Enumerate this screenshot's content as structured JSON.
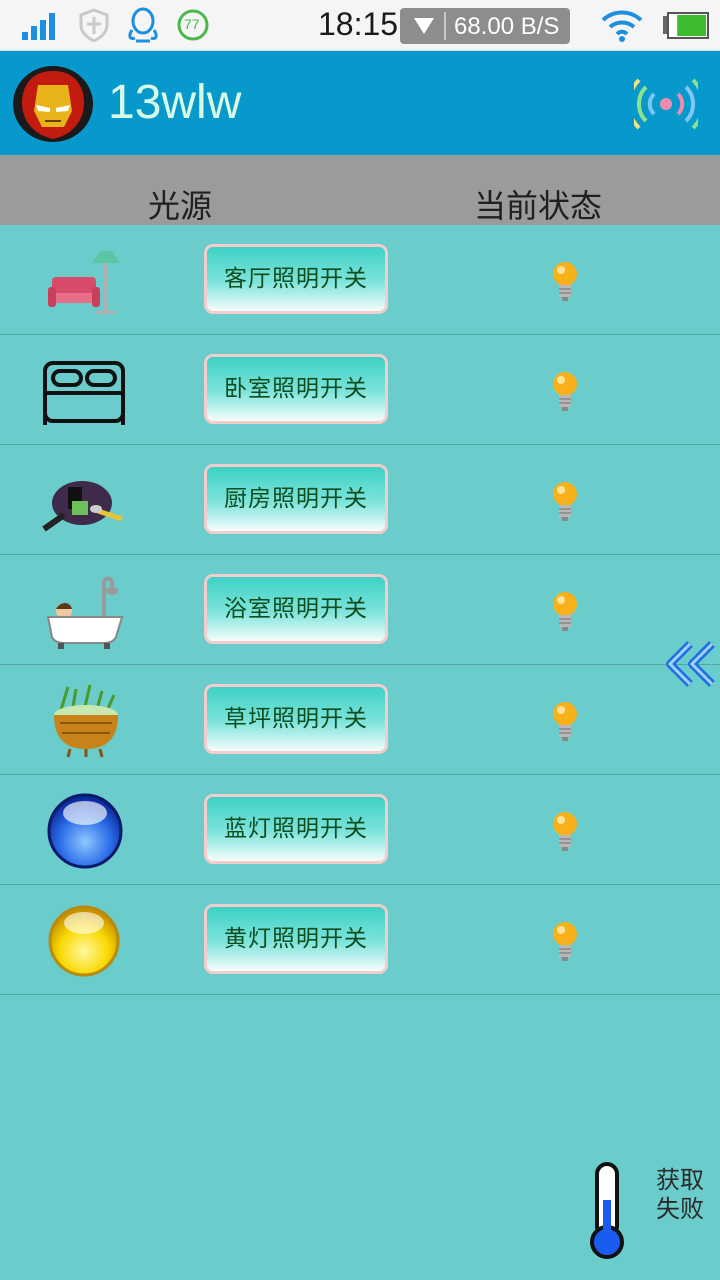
{
  "status_bar": {
    "time": "18:15",
    "net_speed": "68.00 B/S",
    "qq_badge": "77",
    "icons": [
      "signal-icon",
      "shield-icon",
      "qq-icon",
      "badge-icon",
      "download-icon",
      "wifi-icon",
      "battery-icon"
    ],
    "battery_level": 0.8
  },
  "header": {
    "title": "13wlw",
    "avatar": "ironman-avatar-icon",
    "action_icon": "signal-waves-icon",
    "color": "#0899cc"
  },
  "columns": {
    "source": "光源",
    "status": "当前状态"
  },
  "rows": [
    {
      "icon": "living-room-sofa-icon",
      "label": "客厅照明开关",
      "status_icon": "bulb-icon"
    },
    {
      "icon": "bed-icon",
      "label": "卧室照明开关",
      "status_icon": "bulb-icon"
    },
    {
      "icon": "kitchen-pan-icon",
      "label": "厨房照明开关",
      "status_icon": "bulb-icon"
    },
    {
      "icon": "bathtub-icon",
      "label": "浴室照明开关",
      "status_icon": "bulb-icon"
    },
    {
      "icon": "grass-basket-icon",
      "label": "草坪照明开关",
      "status_icon": "bulb-icon"
    },
    {
      "icon": "blue-light-icon",
      "label": "蓝灯照明开关",
      "status_icon": "bulb-icon"
    },
    {
      "icon": "yellow-light-icon",
      "label": "黄灯照明开关",
      "status_icon": "bulb-icon"
    }
  ],
  "temperature": {
    "icon": "thermometer-icon",
    "text_line1": "获取",
    "text_line2": "失败"
  },
  "colors": {
    "background": "#6acdcb",
    "column_header": "#9b9b9b",
    "button_text": "#0e4d1e"
  }
}
